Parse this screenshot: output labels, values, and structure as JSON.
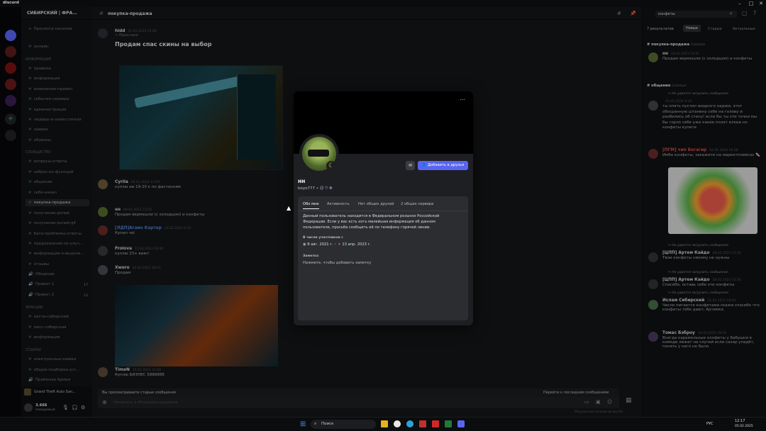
{
  "titlebar": {
    "app": "discord",
    "controls": [
      "–",
      "□",
      "✕"
    ]
  },
  "server": {
    "name": "СИБИРСКИЙ | ФРА..."
  },
  "channels": [
    {
      "label": "Просмотр каналов",
      "top": 0
    },
    {
      "label": "онлайн",
      "top": 0
    }
  ],
  "channel_list": {
    "top_items": [
      "Просмотр каналов",
      "онлайн"
    ],
    "cat_info": "ИНФОРМАЦИЯ",
    "info_items": [
      "правила",
      "информация",
      "изменение-правил",
      "события-сервера",
      "администрация",
      "лидеры-и-заместители",
      "заявки",
      "обзвоны"
    ],
    "cat_community": "СООБЩЕСТВО",
    "community_items": [
      "вопросы-ответы",
      "заброс-из-функций",
      "общение",
      "себе-канал",
      "покупка-продажа",
      "получение-ролей",
      "получение-ролей-gif",
      "баги-проблемы-ответы",
      "предложения-по-улуч...",
      "информация-о-выдаче...",
      "отзывы",
      "Общение",
      "Приват 1",
      "Приват 2"
    ],
    "cat_fractions": "ФРАКЦИИ",
    "fraction_items": [
      "кисти-сибирский",
      "мисс-сибирская",
      "информация"
    ],
    "cat_links": "ССЫЛКИ",
    "link_items": [
      "электронные-заявки",
      "общая-подборка-уст...",
      "Приёмная Армии"
    ],
    "badge_p1": "17",
    "badge_p2": "12"
  },
  "userpanel": {
    "activity": "Grand Theft Auto San...",
    "user": "3.666",
    "status": "Невидимый"
  },
  "chat": {
    "channel": "покупка-продажа",
    "messages": [
      {
        "author": "hidd",
        "time": "25.01.2023 15:08",
        "reply_tag": "Переслано",
        "title": "Продам спас скины на выбор"
      },
      {
        "author": "Cyrila",
        "time": "26.01.2023 13:09",
        "body": "куплю ии 19-20 к по фастонням"
      },
      {
        "author": "нн",
        "time": "09.02.2023 15:51",
        "body": "Продам вермешли (с холодцом) и конфеты"
      },
      {
        "author": "[ЛДП]Агаин Картер",
        "time": "14.02.2023 0:12",
        "body": "Купил чоі"
      },
      {
        "author": "Frolova",
        "time": "15.02.2023 16:40",
        "body": "куплю 23+ вижт"
      },
      {
        "author": "Xwero",
        "time": "22.02.2023 18:01",
        "body": "Продам"
      },
      {
        "author": "TimoN",
        "time": "25.02.2023 12:08",
        "body": "Куплю БИЗНЕС 5888888"
      }
    ],
    "old_notice": "Вы просматриваете старые сообщения",
    "jump_recent": "Перейти к последним сообщениям",
    "input_placeholder": "Написать в #покупка-продажа",
    "slow_mode": "Медленный режим включён"
  },
  "search": {
    "query": "конфеты",
    "results_count": "7 результатов",
    "tabs": [
      "Новые",
      "Старые",
      "Актуальные"
    ],
    "groups": [
      {
        "channel": "покупка-продажа",
        "tag": "Common"
      },
      {
        "channel": "общение",
        "tag": "Common"
      }
    ],
    "results": [
      {
        "author": "нн",
        "time": "09.02.2023 15:51",
        "body": "Продам вермешли (с холодцом) и конфеты"
      },
      {
        "author": "",
        "time": "05.05.2024 9:24",
        "note": "Не удается загрузить сообщения",
        "body": "ты опять пустил жидкого наджи, этот обосранную штанину себе на голову и разбились об стену! если бы ты эти точки мы бы горло себе уже какие полет елкии но конфеты купите"
      },
      {
        "author": "[ПГМ] чип Богагир",
        "time": "04.05.2024 19:38",
        "body": "Имба конфеты, закажите на маркетплейсах 🍬"
      },
      {
        "author": "[ЦПП] Артем Кайдо",
        "time": "28.02.2023 13:33",
        "note": "Не удается загрузить сообщения",
        "body": "Твои конфеты никому не нужны"
      },
      {
        "author": "[ЦПП] Артем Кайдо",
        "time": "28.02.2023 13:30",
        "note": "Не удается загрузить сообщения",
        "body": "Спасибо, оставь себе эти конфеты"
      },
      {
        "author": "Ислам Сибирский",
        "time": "25.02.2023 18:04",
        "note": "Не удается загрузить сообщения",
        "body": "Число питается конфетами скажи спасибо что конфеты тебе дают, Артемка"
      },
      {
        "author": "Томас Бэброу",
        "time": "19.02.2023 19:59",
        "body": "Всегда карамельные конфеты у бабушки в комоде лежат на случай если сахар упадёт, понять у него не было"
      }
    ]
  },
  "profile": {
    "display_name": "нн",
    "username": "boyo777 • ☺",
    "add_friend": "Добавить в друзья",
    "tabs": [
      "Обо мне",
      "Активность",
      "Нет общих друзей",
      "2 общих сервера"
    ],
    "about": "Данный пользователь находится в Федеральном розыске Российской Федерации. Если у вас есть хоть малейшая информация об данном пользователе, просьба сообщить её по телефону горячей линии.",
    "member_label": "В числе участников с",
    "discord_since": "8 авг. 2021 г.",
    "server_since": "13 апр. 2023 г.",
    "note_label": "Заметка",
    "note_placeholder": "Нажмите, чтобы добавить заметку"
  },
  "taskbar": {
    "search": "Поиск",
    "lang": "РУС",
    "time": "12:17",
    "date": "05.02.2025"
  },
  "colors": {
    "blurple": "#5865f2",
    "bg": "#141517",
    "sidebar": "#111214"
  }
}
